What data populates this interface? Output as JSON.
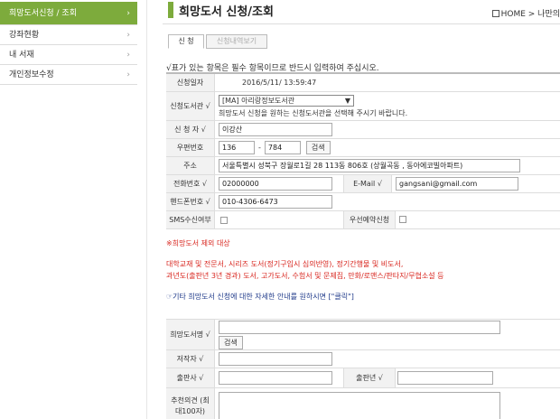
{
  "sidebar": {
    "items": [
      {
        "label": "희망도서신청 / 조회",
        "active": true
      },
      {
        "label": "강좌현황",
        "active": false
      },
      {
        "label": "내 서재",
        "active": false
      },
      {
        "label": "개인정보수정",
        "active": false
      }
    ]
  },
  "header": {
    "title": "희망도서 신청/조회",
    "breadcrumb": "HOME > 나만의"
  },
  "tabs": {
    "apply": "신 청",
    "history": "신청내역보기"
  },
  "notice": "√표가 있는 항목은 필수 항목이므로 반드시 입력하여 주십시오.",
  "form": {
    "date_label": "신청일자",
    "date_value": "2016/5/11/ 13:59:47",
    "library_label": "신청도서관 √",
    "library_value": "[MA] 아리랑정보도서관",
    "library_hint": "희망도서 신청을 원하는 신청도서관을 선택해 주시기 바랍니다.",
    "applicant_label": "신 청 자 √",
    "applicant_value": "이강산",
    "zip_label": "우편번호",
    "zip1": "136",
    "zip_sep": "-",
    "zip2": "784",
    "search_button": "검색",
    "address_label": "주소",
    "address_value": "서울특별시 성북구 장월로1길 28 113동 806호 (상월곡동 , 동아에코빌아파트)",
    "phone_label": "전화번호 √",
    "phone_value": "02000000",
    "email_label": "E-Mail √",
    "email_value": "gangsani@gmail.com",
    "mobile_label": "핸드폰번호 √",
    "mobile_value": "010-4306-6473",
    "sms_label": "SMS수신여부",
    "reserve_label": "우선예약신청",
    "excluded_title": "※희망도서 제외 대상",
    "excluded_line1": "대학교재 및 전문서, 시리즈 도서(정기구입시 심의반영), 정기간행물 및 비도서,",
    "excluded_line2": "과년도(출판년 3년 경과) 도서, 고가도서, 수험서 및 문제집, 만화/로맨스/판타지/무협소설 등",
    "guide_text": "☞기타 희망도서 신청에 대한 자세한 안내를 원하시면 [\"클릭\"]",
    "book_label": "희망도서명 √",
    "book_search": "검색",
    "author_label": "저작자 √",
    "publisher_label": "출판사 √",
    "pubyear_label": "출판년 √",
    "opinion_label": "추천의견 (최대100자)"
  }
}
